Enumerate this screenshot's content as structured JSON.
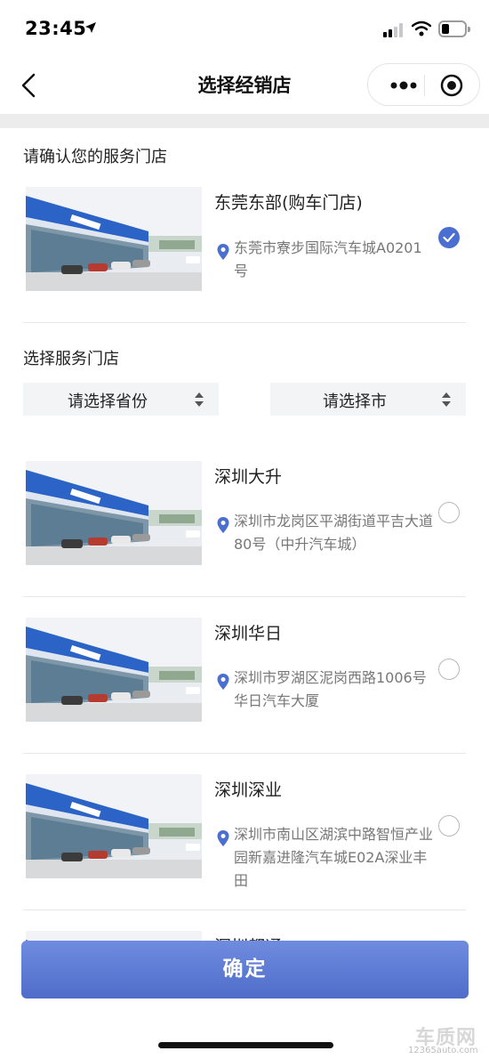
{
  "status_bar": {
    "time": "23:45"
  },
  "nav": {
    "title": "选择经销店"
  },
  "current_section": {
    "label": "请确认您的服务门店",
    "store": {
      "name": "东莞东部(购车门店)",
      "address": "东莞市寮步国际汽车城A0201号",
      "selected": true
    }
  },
  "filter_section": {
    "label": "选择服务门店",
    "province_select": {
      "label": "请选择省份"
    },
    "city_select": {
      "label": "请选择市"
    }
  },
  "stores": [
    {
      "name": "深圳大升",
      "address": "深圳市龙岗区平湖街道平吉大道80号（中升汽车城）",
      "selected": false
    },
    {
      "name": "深圳华日",
      "address": "深圳市罗湖区泥岗西路1006号华日汽车大厦",
      "selected": false
    },
    {
      "name": "深圳深业",
      "address": "深圳市南山区湖滨中路智恒产业园新嘉进隆汽车城E02A深业丰田",
      "selected": false
    },
    {
      "name": "深圳都通"
    }
  ],
  "confirm_button": {
    "label": "确定"
  },
  "watermark": {
    "logo": "车质网",
    "url": "12365auto.com"
  },
  "colors": {
    "accent": "#4a6fd0",
    "button_top": "#6f8ce0",
    "button_bottom": "#4f6dc9"
  },
  "icons": [
    "location-arrow-icon",
    "signal-icon",
    "wifi-icon",
    "battery-icon",
    "back-chevron-icon",
    "more-dots-icon",
    "close-circle-icon",
    "location-pin-icon",
    "sort-caret-icon",
    "check-icon"
  ]
}
